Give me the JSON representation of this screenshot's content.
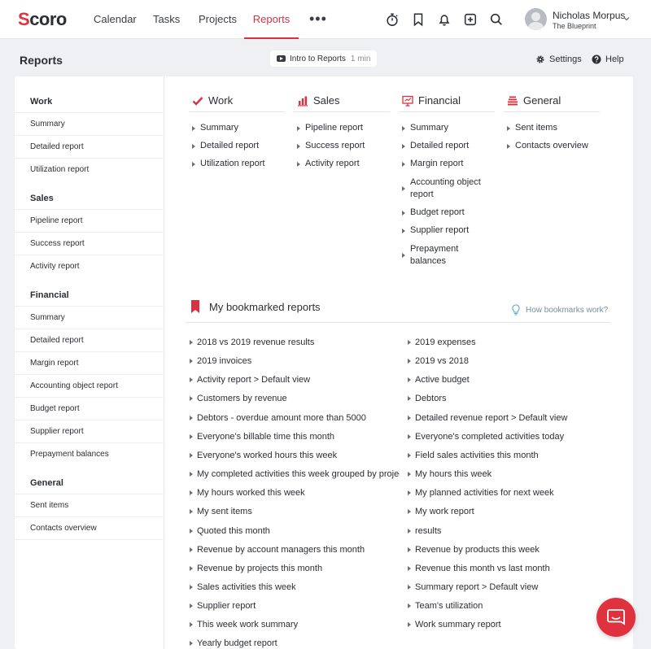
{
  "brand": {
    "logo_text": "coro",
    "logo_initial": "S",
    "accent": "#d9323f"
  },
  "nav": {
    "items": [
      {
        "label": "Calendar"
      },
      {
        "label": "Tasks"
      },
      {
        "label": "Projects"
      },
      {
        "label": "Reports",
        "active": true
      }
    ],
    "more": "•••"
  },
  "toolbar_icons": [
    "stopwatch-icon",
    "bookmark-icon",
    "bell-icon",
    "plus-square-icon",
    "search-icon"
  ],
  "user": {
    "name": "Nicholas Morpus",
    "company": "The Blueprint"
  },
  "page": {
    "title": "Reports",
    "intro_label": "Intro to Reports",
    "intro_duration": "1 min",
    "settings_label": "Settings",
    "help_label": "Help"
  },
  "sidebar": {
    "sections": [
      {
        "heading": "Work",
        "items": [
          "Summary",
          "Detailed report",
          "Utilization report"
        ]
      },
      {
        "heading": "Sales",
        "items": [
          "Pipeline report",
          "Success report",
          "Activity report"
        ]
      },
      {
        "heading": "Financial",
        "items": [
          "Summary",
          "Detailed report",
          "Margin report",
          "Accounting object report",
          "Budget report",
          "Supplier report",
          "Prepayment balances"
        ]
      },
      {
        "heading": "General",
        "items": [
          "Sent items",
          "Contacts overview"
        ]
      }
    ]
  },
  "categories": [
    {
      "title": "Work",
      "icon": "checkmark-icon",
      "links": [
        "Summary",
        "Detailed report",
        "Utilization report"
      ]
    },
    {
      "title": "Sales",
      "icon": "bar-chart-icon",
      "links": [
        "Pipeline report",
        "Success report",
        "Activity report"
      ]
    },
    {
      "title": "Financial",
      "icon": "presentation-chart-icon",
      "links": [
        "Summary",
        "Detailed report",
        "Margin report",
        "Accounting object report",
        "Budget report",
        "Supplier report",
        "Prepayment balances"
      ]
    },
    {
      "title": "General",
      "icon": "stack-list-icon",
      "links": [
        "Sent items",
        "Contacts overview"
      ]
    }
  ],
  "bookmarks": {
    "title": "My bookmarked reports",
    "help": "How bookmarks work?",
    "left": [
      "2018 vs 2019 revenue results",
      "2019 invoices",
      "Activity report > Default view",
      "Customers by revenue",
      "Debtors - overdue amount more than 5000",
      "Everyone's billable time this month",
      "Everyone's worked hours this week",
      "My completed activities this week grouped by project",
      "My hours worked this week",
      "My sent items",
      "Quoted this month",
      "Revenue by account managers this month",
      "Revenue by projects this month",
      "Sales activities this week",
      "Supplier report",
      "This week work summary",
      "Yearly budget report"
    ],
    "right": [
      "2019 expenses",
      "2019 vs 2018",
      "Active budget",
      "Debtors",
      "Detailed revenue report > Default view",
      "Everyone's completed activities today",
      "Field sales activities this month",
      "My hours this week",
      "My planned activities for next week",
      "My work report",
      "results",
      "Revenue by products this week",
      "Revenue this month vs last month",
      "Summary report > Default view",
      "Team's utilization",
      "Work summary report"
    ]
  }
}
